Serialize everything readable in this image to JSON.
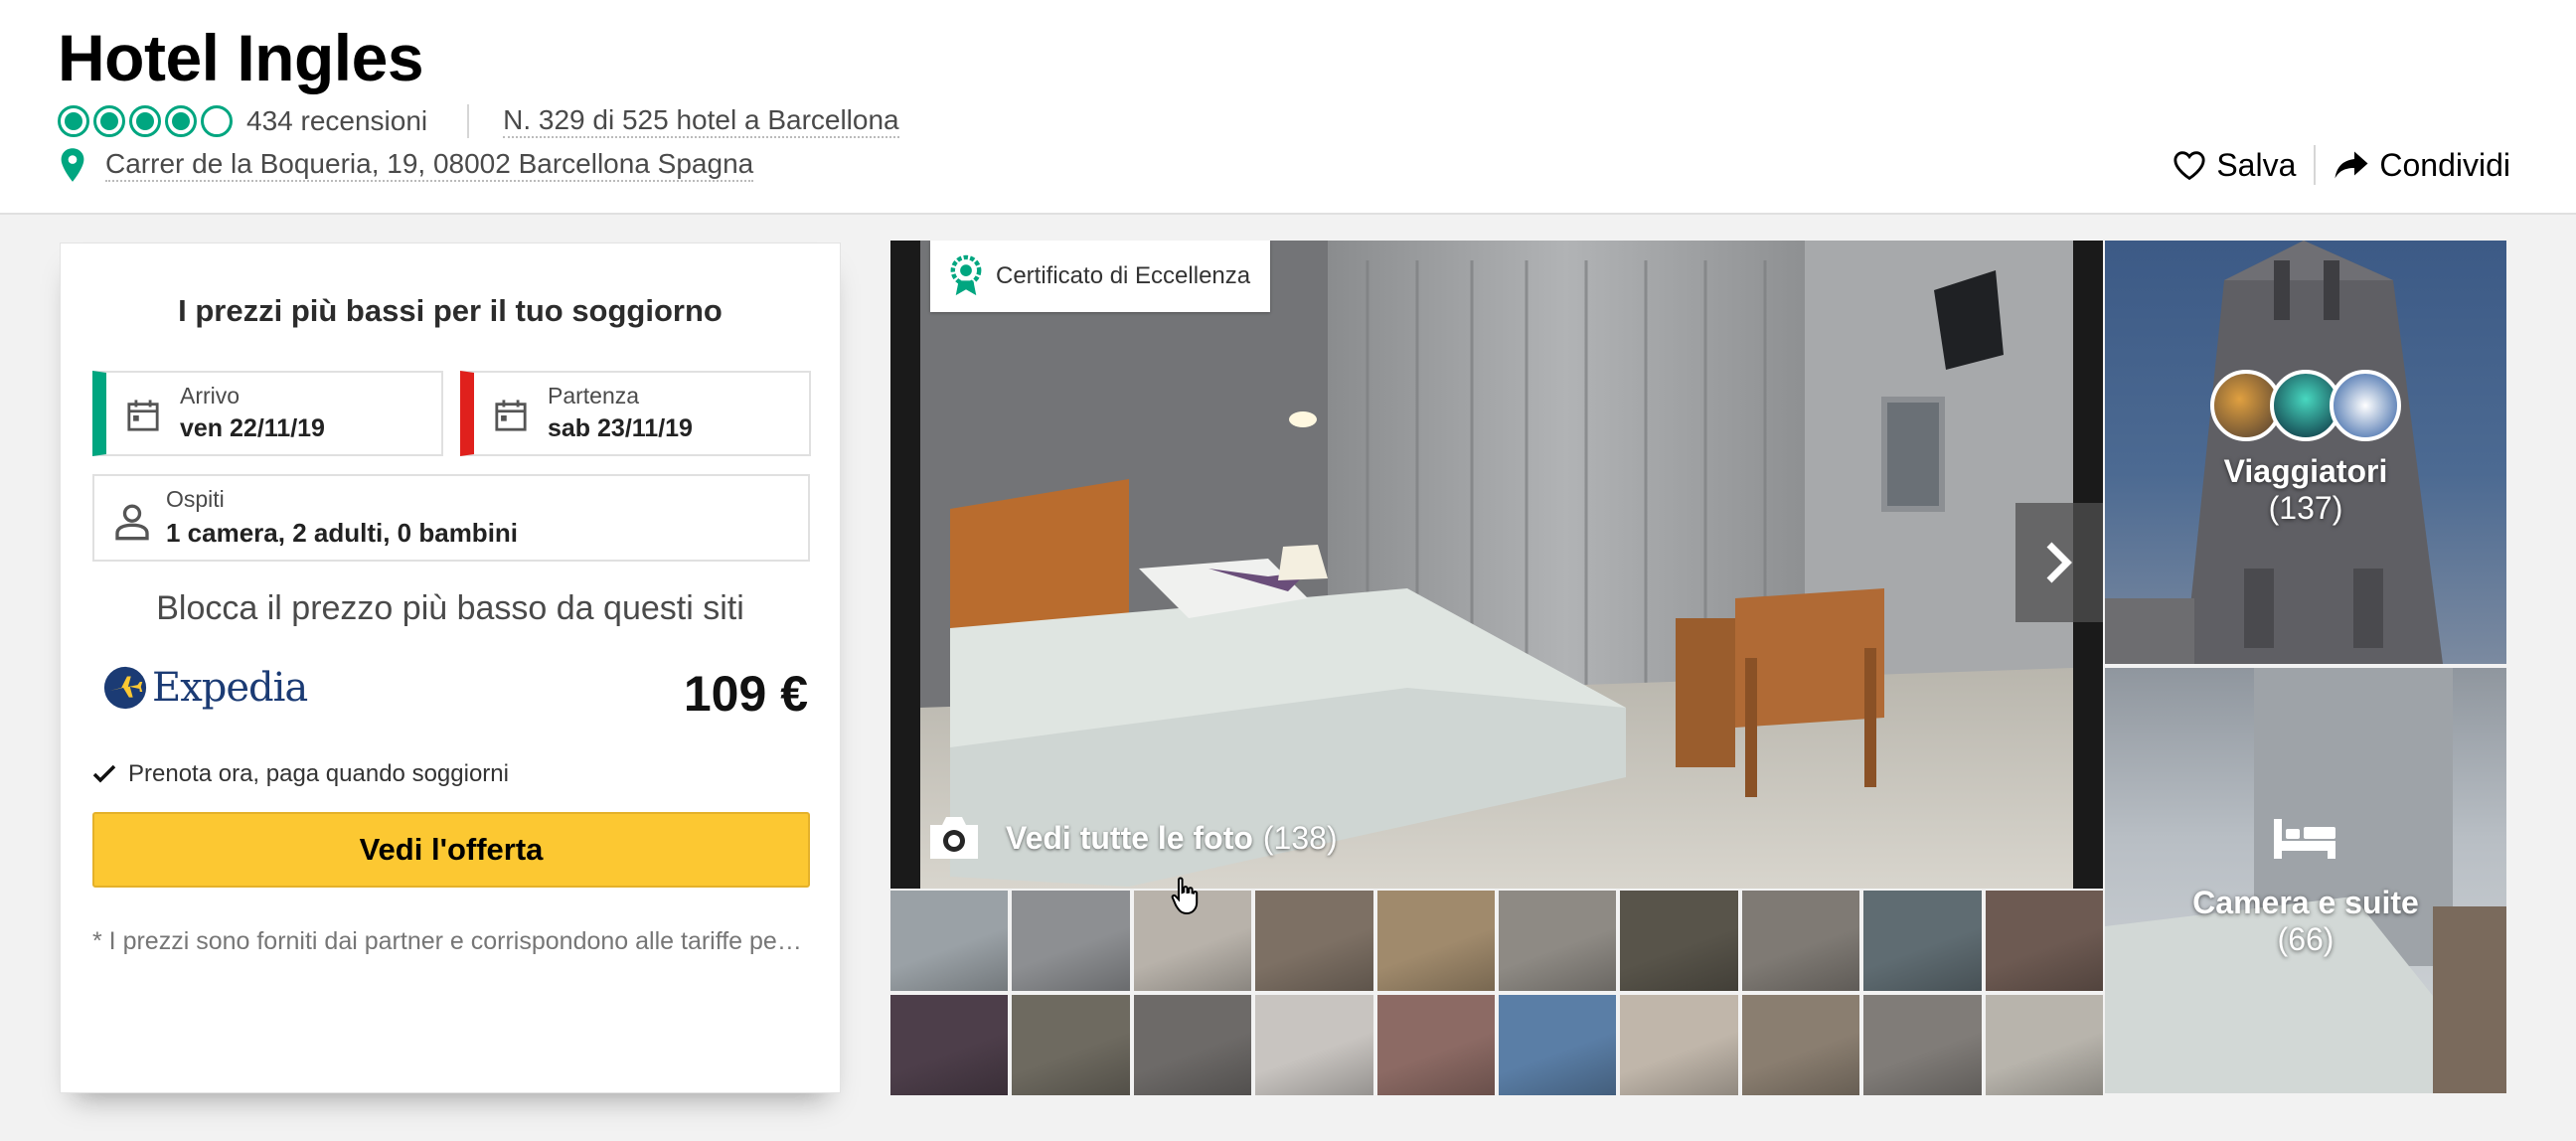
{
  "header": {
    "hotel_name": "Hotel Ingles",
    "rating_bubbles": 4,
    "reviews": "434 recensioni",
    "rank": "N. 329 di 525 hotel a Barcellona",
    "address": "Carrer de la Boqueria, 19, 08002 Barcellona Spagna",
    "save_label": "Salva",
    "share_label": "Condividi"
  },
  "booking": {
    "title": "I prezzi più bassi per il tuo soggiorno",
    "arrival_label": "Arrivo",
    "arrival_value": "ven 22/11/19",
    "departure_label": "Partenza",
    "departure_value": "sab 23/11/19",
    "guests_label": "Ospiti",
    "guests_value": "1 camera, 2 adulti, 0 bambini",
    "block_price_text": "Blocca il prezzo più basso da questi siti",
    "provider": "Expedia",
    "price": "109 €",
    "pay_later": "Prenota ora, paga quando soggiorni",
    "offer_button": "Vedi l'offerta",
    "disclaimer": "* I prezzi sono forniti dai partner e corrispondono alle tariffe per camera, incluse tasse e commissioni."
  },
  "gallery": {
    "certificate": "Certificato di Eccellenza",
    "see_all_label": "Vedi tutte le foto",
    "see_all_count": "(138)",
    "thumb_colors": [
      "#9aa1a6",
      "#8d8f92",
      "#b8b2aa",
      "#7d7064",
      "#a08a6c",
      "#8e8a84",
      "#58544a",
      "#7f7a74",
      "#5f6c72",
      "#6d5a52",
      "#4d3e4a",
      "#6e6a60",
      "#6d6a68",
      "#c8c4c0",
      "#8c6a64",
      "#5a7ea6",
      "#c0b6aa",
      "#8a7e70",
      "#807c78",
      "#b8b4ac"
    ],
    "travelers_label": "Viaggiatori",
    "travelers_count": "(137)",
    "rooms_label": "Camera e suite",
    "rooms_count": "(66)",
    "accent": "#00a680"
  }
}
